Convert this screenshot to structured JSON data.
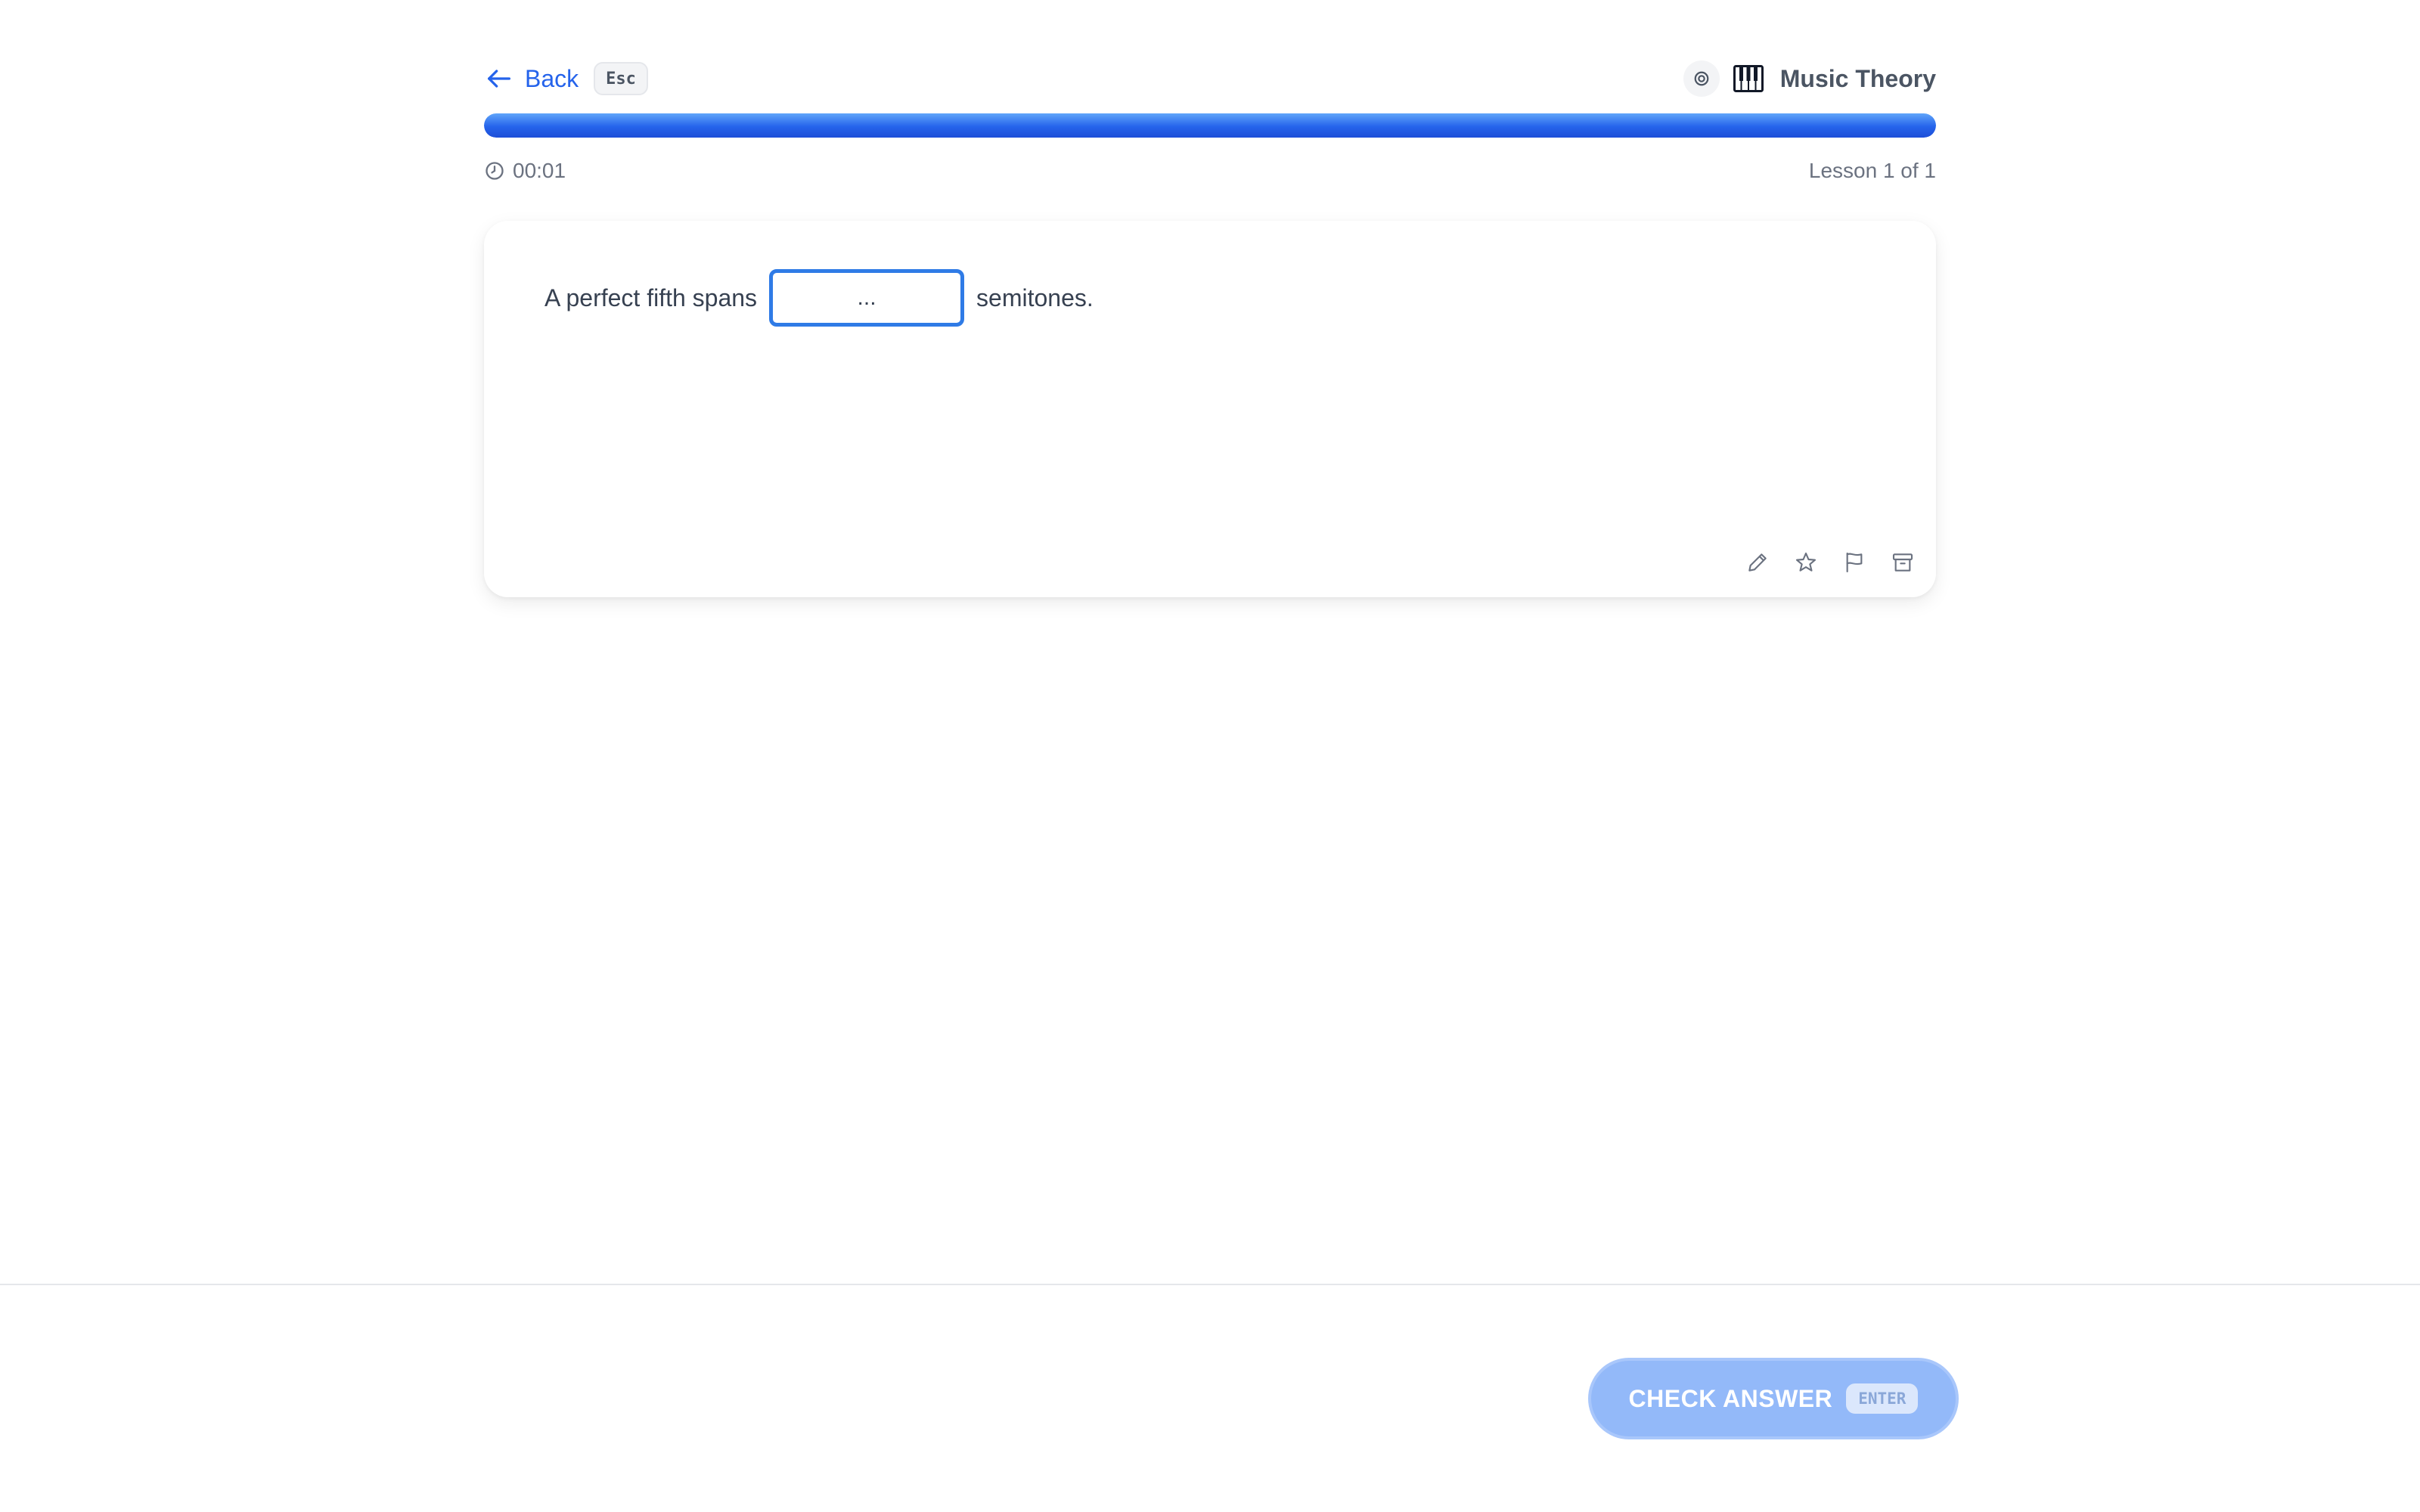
{
  "header": {
    "back_label": "Back",
    "back_shortcut": "Esc",
    "course_title": "Music Theory"
  },
  "progress": {
    "fraction": 1.0
  },
  "status": {
    "timer": "00:01",
    "lesson_counter": "Lesson 1 of 1"
  },
  "question": {
    "prefix": "A perfect fifth spans",
    "suffix": "semitones.",
    "answer_value": "",
    "answer_placeholder": "..."
  },
  "footer": {
    "check_label": "CHECK ANSWER",
    "check_shortcut": "ENTER"
  },
  "colors": {
    "accent": "#2563eb",
    "button_disabled": "#93b9f9"
  },
  "icons": [
    "arrow-left-icon",
    "target-icon",
    "piano-icon",
    "clock-icon",
    "pencil-icon",
    "star-icon",
    "flag-icon",
    "archive-icon"
  ]
}
